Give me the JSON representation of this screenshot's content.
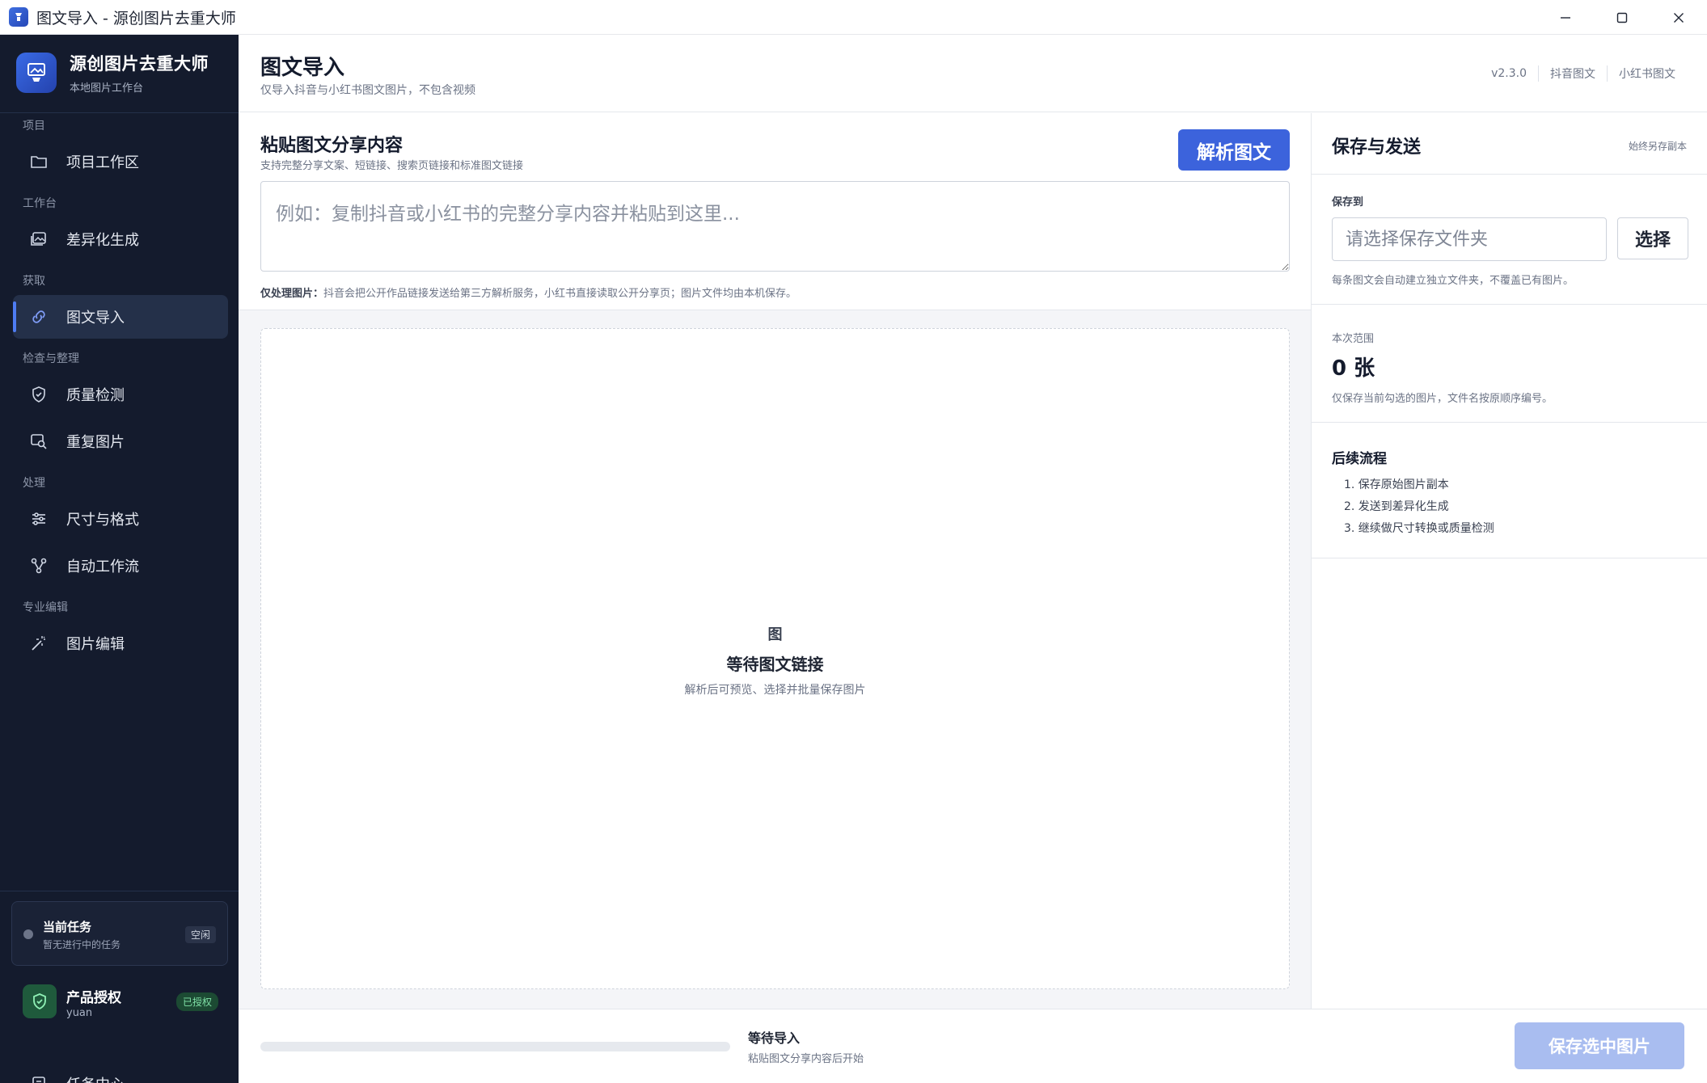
{
  "window": {
    "title": "图文导入 - 源创图片去重大师"
  },
  "brand": {
    "name": "源创图片去重大师",
    "subtitle": "本地图片工作台"
  },
  "sidebar": {
    "groups": [
      {
        "label": "项目",
        "items": [
          {
            "label": "项目工作区",
            "icon": "folder-icon"
          }
        ]
      },
      {
        "label": "工作台",
        "items": [
          {
            "label": "差异化生成",
            "icon": "image-icon"
          }
        ]
      },
      {
        "label": "获取",
        "items": [
          {
            "label": "图文导入",
            "icon": "link-icon",
            "active": true
          }
        ]
      },
      {
        "label": "检查与整理",
        "items": [
          {
            "label": "质量检测",
            "icon": "shield-icon"
          },
          {
            "label": "重复图片",
            "icon": "image-search-icon"
          }
        ]
      },
      {
        "label": "处理",
        "items": [
          {
            "label": "尺寸与格式",
            "icon": "sliders-icon"
          },
          {
            "label": "自动工作流",
            "icon": "workflow-icon"
          }
        ]
      },
      {
        "label": "专业编辑",
        "items": [
          {
            "label": "图片编辑",
            "icon": "magic-wand-icon"
          }
        ]
      }
    ],
    "task": {
      "title": "当前任务",
      "subtitle": "暂无进行中的任务",
      "badge": "空闲"
    },
    "license": {
      "title": "产品授权",
      "user": "yuan",
      "badge": "已授权"
    },
    "task_center": {
      "label": "任务中心"
    }
  },
  "header": {
    "title": "图文导入",
    "subtitle": "仅导入抖音与小红书图文图片，不包含视频",
    "links": [
      "v2.3.0",
      "抖音图文",
      "小红书图文"
    ]
  },
  "paste": {
    "title": "粘贴图文分享内容",
    "subtitle": "支持完整分享文案、短链接、搜索页链接和标准图文链接",
    "parse_label": "解析图文",
    "placeholder": "例如：复制抖音或小红书的完整分享内容并粘贴到这里...",
    "note_bold": "仅处理图片：",
    "note_text": "抖音会把公开作品链接发送给第三方解析服务，小红书直接读取公开分享页；图片文件均由本机保存。"
  },
  "drop": {
    "icon_text": "图",
    "title": "等待图文链接",
    "subtitle": "解析后可预览、选择并批量保存图片"
  },
  "right": {
    "title": "保存与发送",
    "hint": "始终另存副本",
    "save_to_label": "保存到",
    "folder_placeholder": "请选择保存文件夹",
    "choose_label": "选择",
    "folder_note": "每条图文会自动建立独立文件夹，不覆盖已有图片。",
    "scope_label": "本次范围",
    "scope_count": "0 张",
    "scope_note": "仅保存当前勾选的图片，文件名按原顺序编号。",
    "flow_title": "后续流程",
    "flow": [
      "1. 保存原始图片副本",
      "2. 发送到差异化生成",
      "3. 继续做尺寸转换或质量检测"
    ]
  },
  "footer": {
    "progress": 0,
    "status": "等待导入",
    "status_sub": "粘贴图文分享内容后开始",
    "save_label": "保存选中图片"
  },
  "colors": {
    "accent": "#3c63dc",
    "sidebar_bg": "#141b2d",
    "disabled_button": "#a9bdf0"
  }
}
